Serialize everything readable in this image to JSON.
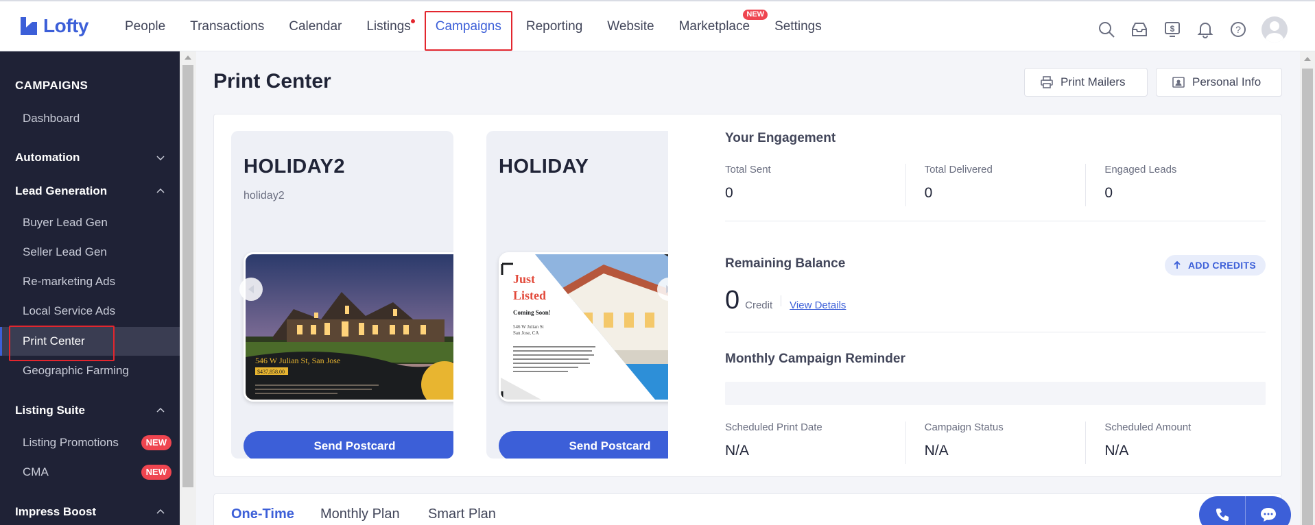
{
  "app": {
    "name": "Lofty"
  },
  "nav": {
    "items": [
      {
        "label": "People"
      },
      {
        "label": "Transactions"
      },
      {
        "label": "Calendar"
      },
      {
        "label": "Listings"
      },
      {
        "label": "Campaigns"
      },
      {
        "label": "Reporting"
      },
      {
        "label": "Website"
      },
      {
        "label": "Marketplace"
      },
      {
        "label": "Settings"
      }
    ],
    "marketplace_badge": "NEW",
    "icons": [
      "search-icon",
      "inbox-icon",
      "billing-icon",
      "bell-icon",
      "help-icon",
      "avatar"
    ]
  },
  "sidebar": {
    "title": "CAMPAIGNS",
    "items": [
      {
        "label": "Dashboard",
        "type": "sub"
      },
      {
        "label": "Automation",
        "type": "group",
        "chevron": "down"
      },
      {
        "label": "Lead Generation",
        "type": "group",
        "chevron": "up"
      },
      {
        "label": "Buyer Lead Gen",
        "type": "sub"
      },
      {
        "label": "Seller Lead Gen",
        "type": "sub"
      },
      {
        "label": "Re-marketing Ads",
        "type": "sub"
      },
      {
        "label": "Local Service Ads",
        "type": "sub"
      },
      {
        "label": "Print Center",
        "type": "sub",
        "selected": true
      },
      {
        "label": "Geographic Farming",
        "type": "sub"
      },
      {
        "label": "Listing Suite",
        "type": "group",
        "chevron": "up"
      },
      {
        "label": "Listing Promotions",
        "type": "sub",
        "badge": "NEW"
      },
      {
        "label": "CMA",
        "type": "sub",
        "badge": "NEW"
      },
      {
        "label": "Impress Boost",
        "type": "group",
        "chevron": "up"
      }
    ]
  },
  "page": {
    "title": "Print Center",
    "print_mailers": "Print Mailers",
    "personal_info": "Personal Info"
  },
  "cards": [
    {
      "title": "HOLIDAY2",
      "subtitle": "holiday2",
      "address": "546 W Julian St, San Jose",
      "price": "$437,858.00",
      "button": "Send Postcard"
    },
    {
      "title": "HOLIDAY",
      "subtitle": "",
      "headline_1": "Just",
      "headline_2": "Listed",
      "coming": "Coming Soon!",
      "addr_1": "546 W Julian St",
      "addr_2": "San Jose, CA",
      "button": "Send Postcard"
    }
  ],
  "engagement": {
    "title": "Your Engagement",
    "stats": [
      {
        "label": "Total Sent",
        "value": "0"
      },
      {
        "label": "Total Delivered",
        "value": "0"
      },
      {
        "label": "Engaged Leads",
        "value": "0"
      }
    ]
  },
  "balance": {
    "title": "Remaining Balance",
    "add_credits": "ADD CREDITS",
    "value": "0",
    "unit": "Credit",
    "link": "View Details"
  },
  "reminder": {
    "title": "Monthly Campaign Reminder",
    "stats": [
      {
        "label": "Scheduled Print Date",
        "value": "N/A"
      },
      {
        "label": "Campaign Status",
        "value": "N/A"
      },
      {
        "label": "Scheduled Amount",
        "value": "N/A"
      }
    ]
  },
  "tabs": [
    {
      "label": "One-Time",
      "active": true
    },
    {
      "label": "Monthly Plan"
    },
    {
      "label": "Smart Plan"
    }
  ],
  "colors": {
    "accent": "#3c5fd8",
    "sidebar": "#1f2236",
    "badge": "#ef4550",
    "highlight": "#e3262e"
  }
}
